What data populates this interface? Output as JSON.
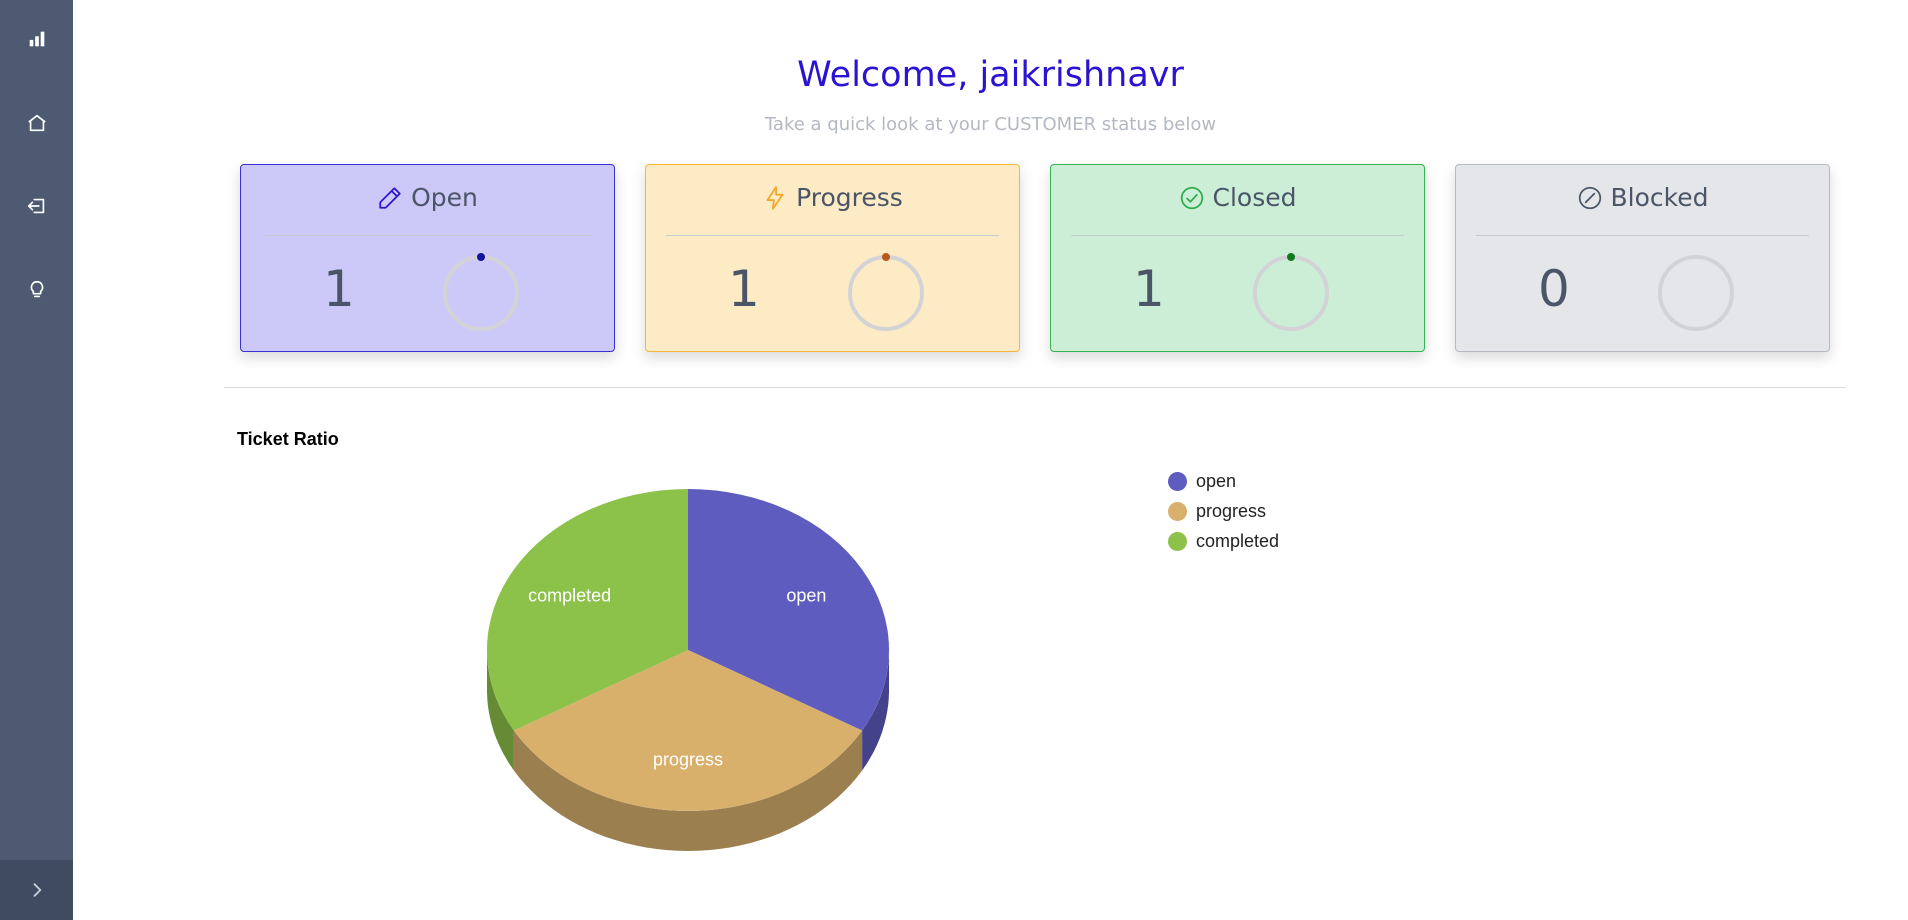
{
  "header": {
    "welcome": "Welcome, jaikrishnavr",
    "subtitle": "Take a quick look at your CUSTOMER status below"
  },
  "sidebar": {
    "items": [
      {
        "icon": "bar-chart-icon"
      },
      {
        "icon": "home-icon"
      },
      {
        "icon": "logout-icon"
      },
      {
        "icon": "lightbulb-icon"
      }
    ],
    "toggle_icon": "chevron-right-icon"
  },
  "cards": [
    {
      "label": "Open",
      "count": "1",
      "icon": "pencil-icon",
      "bg": "#ccc9f8",
      "border": "#3b2fd6",
      "dot": "#14139c",
      "icon_color": "#2a14d1"
    },
    {
      "label": "Progress",
      "count": "1",
      "icon": "lightning-icon",
      "bg": "#fdebc5",
      "border": "#f5b53e",
      "dot": "#b85b1d",
      "icon_color": "#f5a623"
    },
    {
      "label": "Closed",
      "count": "1",
      "icon": "check-circle-icon",
      "bg": "#cdeed6",
      "border": "#33b754",
      "dot": "#117a1e",
      "icon_color": "#2eab4d"
    },
    {
      "label": "Blocked",
      "count": "0",
      "icon": "slash-circle-icon",
      "bg": "#e4e6ea",
      "border": "#b6bbc3",
      "dot": null,
      "icon_color": "#4a5568"
    }
  ],
  "chart_data": {
    "type": "pie",
    "title": "Ticket Ratio",
    "categories": [
      "open",
      "progress",
      "completed"
    ],
    "values": [
      1,
      1,
      1
    ],
    "colors": [
      "#5f5cbf",
      "#d8b06c",
      "#8cc14a"
    ],
    "legend": "top-right"
  }
}
